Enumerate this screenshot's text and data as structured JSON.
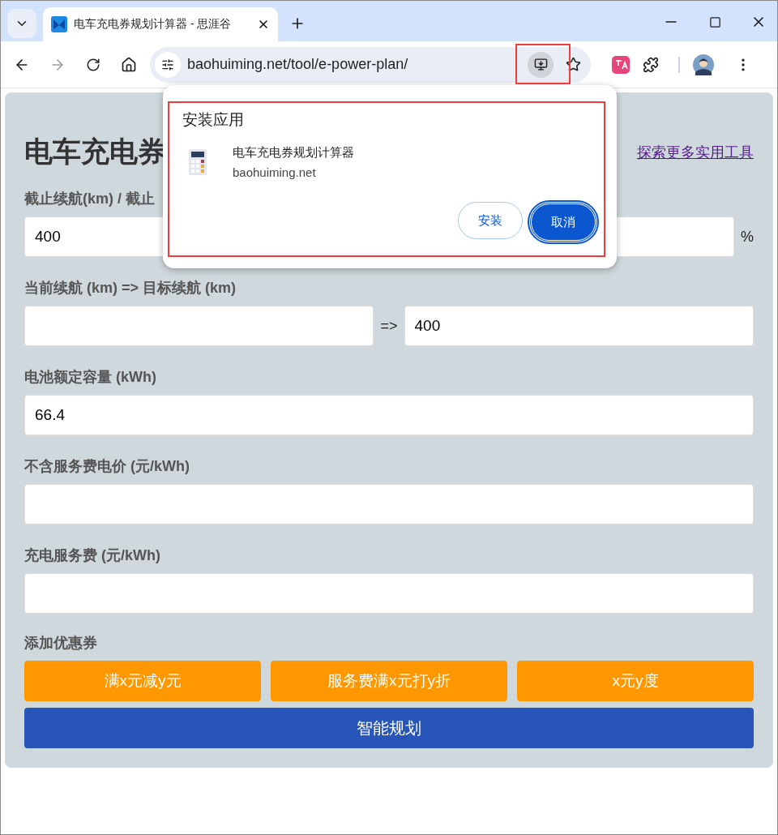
{
  "browser": {
    "tab": {
      "title": "电车充电券规划计算器 - 思涯谷",
      "selected": true
    },
    "url": "baohuiming.net/tool/e-power-plan/",
    "forward_disabled": true
  },
  "page": {
    "heading": "电车充电券",
    "link": "探索更多实用工具",
    "fields": [
      {
        "kind": "pair",
        "label": "截止续航(km) / 截止",
        "value": "400",
        "unit": "%"
      },
      {
        "kind": "range",
        "label": "当前续航 (km) => 目标续航 (km)",
        "separator": "=>",
        "to_value": "400"
      },
      {
        "kind": "single",
        "label": "电池额定容量 (kWh)",
        "value": "66.4"
      },
      {
        "kind": "single",
        "label": "不含服务费电价 (元/kWh)"
      },
      {
        "kind": "single",
        "label": "充电服务费 (元/kWh)"
      }
    ],
    "coupon_label": "添加优惠券",
    "coupon_buttons": [
      "满x元减y元",
      "服务费满x元打y折",
      "x元y度"
    ],
    "plan_button": "智能规划"
  },
  "install_popup": {
    "title": "安装应用",
    "app_name": "电车充电券规划计算器",
    "domain": "baohuiming.net",
    "buttons": [
      {
        "label": "安装",
        "selected": false
      },
      {
        "label": "取消",
        "selected": true
      }
    ]
  }
}
